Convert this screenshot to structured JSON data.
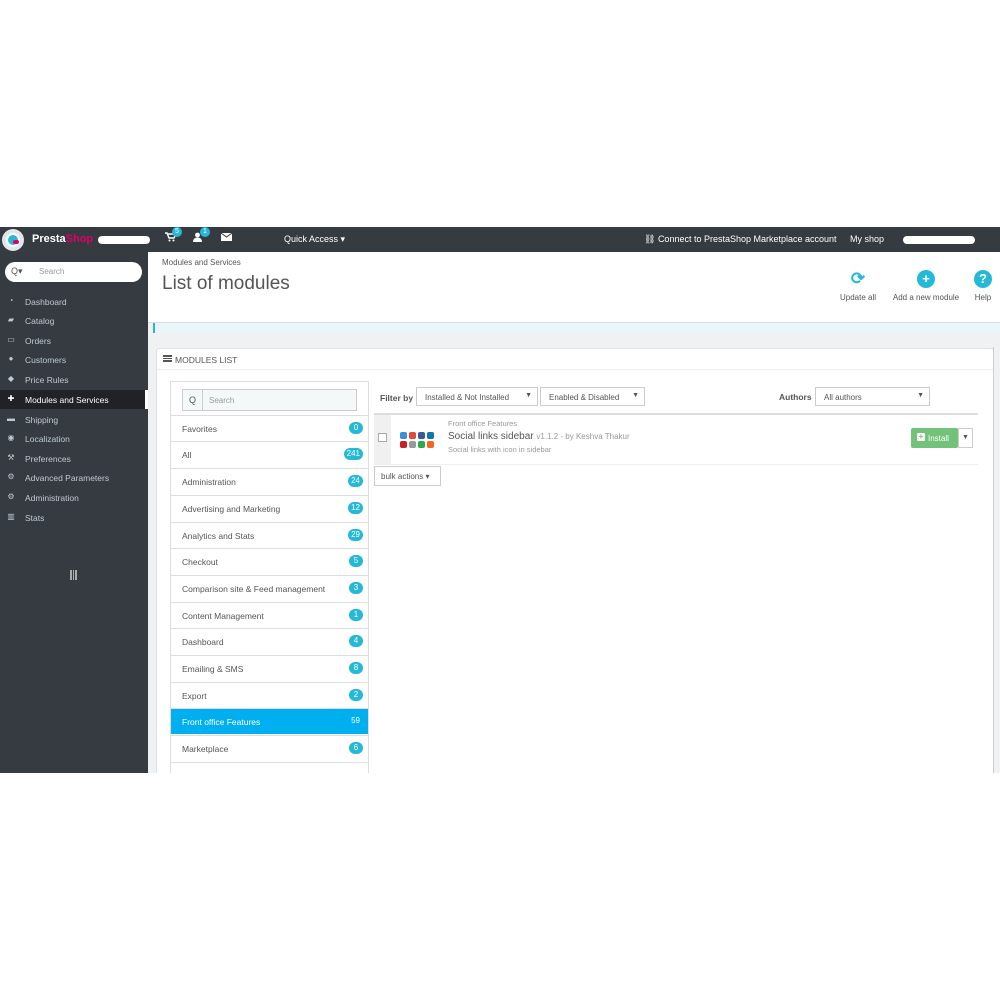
{
  "topbar": {
    "brand_main": "Presta",
    "brand_accent": "Shop",
    "cart_count": "5",
    "customers_count": "1",
    "quick_access": "Quick Access ▾",
    "connect": "Connect to PrestaShop Marketplace account",
    "my_shop": "My shop"
  },
  "sidebar": {
    "search_placeholder": "Search",
    "items": [
      {
        "label": "Dashboard",
        "icon": "dashboard-icon"
      },
      {
        "label": "Catalog",
        "icon": "book-icon"
      },
      {
        "label": "Orders",
        "icon": "credit-card-icon"
      },
      {
        "label": "Customers",
        "icon": "users-icon"
      },
      {
        "label": "Price Rules",
        "icon": "tag-icon"
      },
      {
        "label": "Modules and Services",
        "icon": "puzzle-icon",
        "active": true
      },
      {
        "label": "Shipping",
        "icon": "truck-icon"
      },
      {
        "label": "Localization",
        "icon": "globe-icon"
      },
      {
        "label": "Preferences",
        "icon": "wrench-icon"
      },
      {
        "label": "Advanced Parameters",
        "icon": "cogs-icon"
      },
      {
        "label": "Administration",
        "icon": "gear-icon"
      },
      {
        "label": "Stats",
        "icon": "bar-chart-icon"
      }
    ]
  },
  "header": {
    "breadcrumb": "Modules and Services",
    "title": "List of modules",
    "toolbar": {
      "update_all": "Update all",
      "add_module": "Add a new module",
      "help": "Help"
    }
  },
  "panel": {
    "heading": "MODULES LIST"
  },
  "categories": {
    "search_placeholder": "Search",
    "items": [
      {
        "label": "Favorites",
        "count": "0"
      },
      {
        "label": "All",
        "count": "241"
      },
      {
        "label": "Administration",
        "count": "24"
      },
      {
        "label": "Advertising and Marketing",
        "count": "12"
      },
      {
        "label": "Analytics and Stats",
        "count": "29"
      },
      {
        "label": "Checkout",
        "count": "5"
      },
      {
        "label": "Comparison site & Feed management",
        "count": "3"
      },
      {
        "label": "Content Management",
        "count": "1"
      },
      {
        "label": "Dashboard",
        "count": "4"
      },
      {
        "label": "Emailing & SMS",
        "count": "8"
      },
      {
        "label": "Export",
        "count": "2"
      },
      {
        "label": "Front office Features",
        "count": "59",
        "active": true
      },
      {
        "label": "Marketplace",
        "count": "6"
      }
    ]
  },
  "filters": {
    "filter_by": "Filter by",
    "install_state": "Installed & Not Installed",
    "enabled_state": "Enabled & Disabled",
    "authors_label": "Authors",
    "authors_value": "All authors"
  },
  "module": {
    "category": "Front office Features",
    "name": "Social links sidebar",
    "version": "v1.1.2 - by Keshva Thakur",
    "description": "Social links with icon in sidebar",
    "install_label": "Install"
  },
  "bulk_actions": "bulk actions ▾",
  "colors": {
    "topbar": "#363a41",
    "accent": "#25b9d7",
    "brand_accent": "#df0067",
    "active_category": "#00aff0",
    "install": "#72c279"
  }
}
